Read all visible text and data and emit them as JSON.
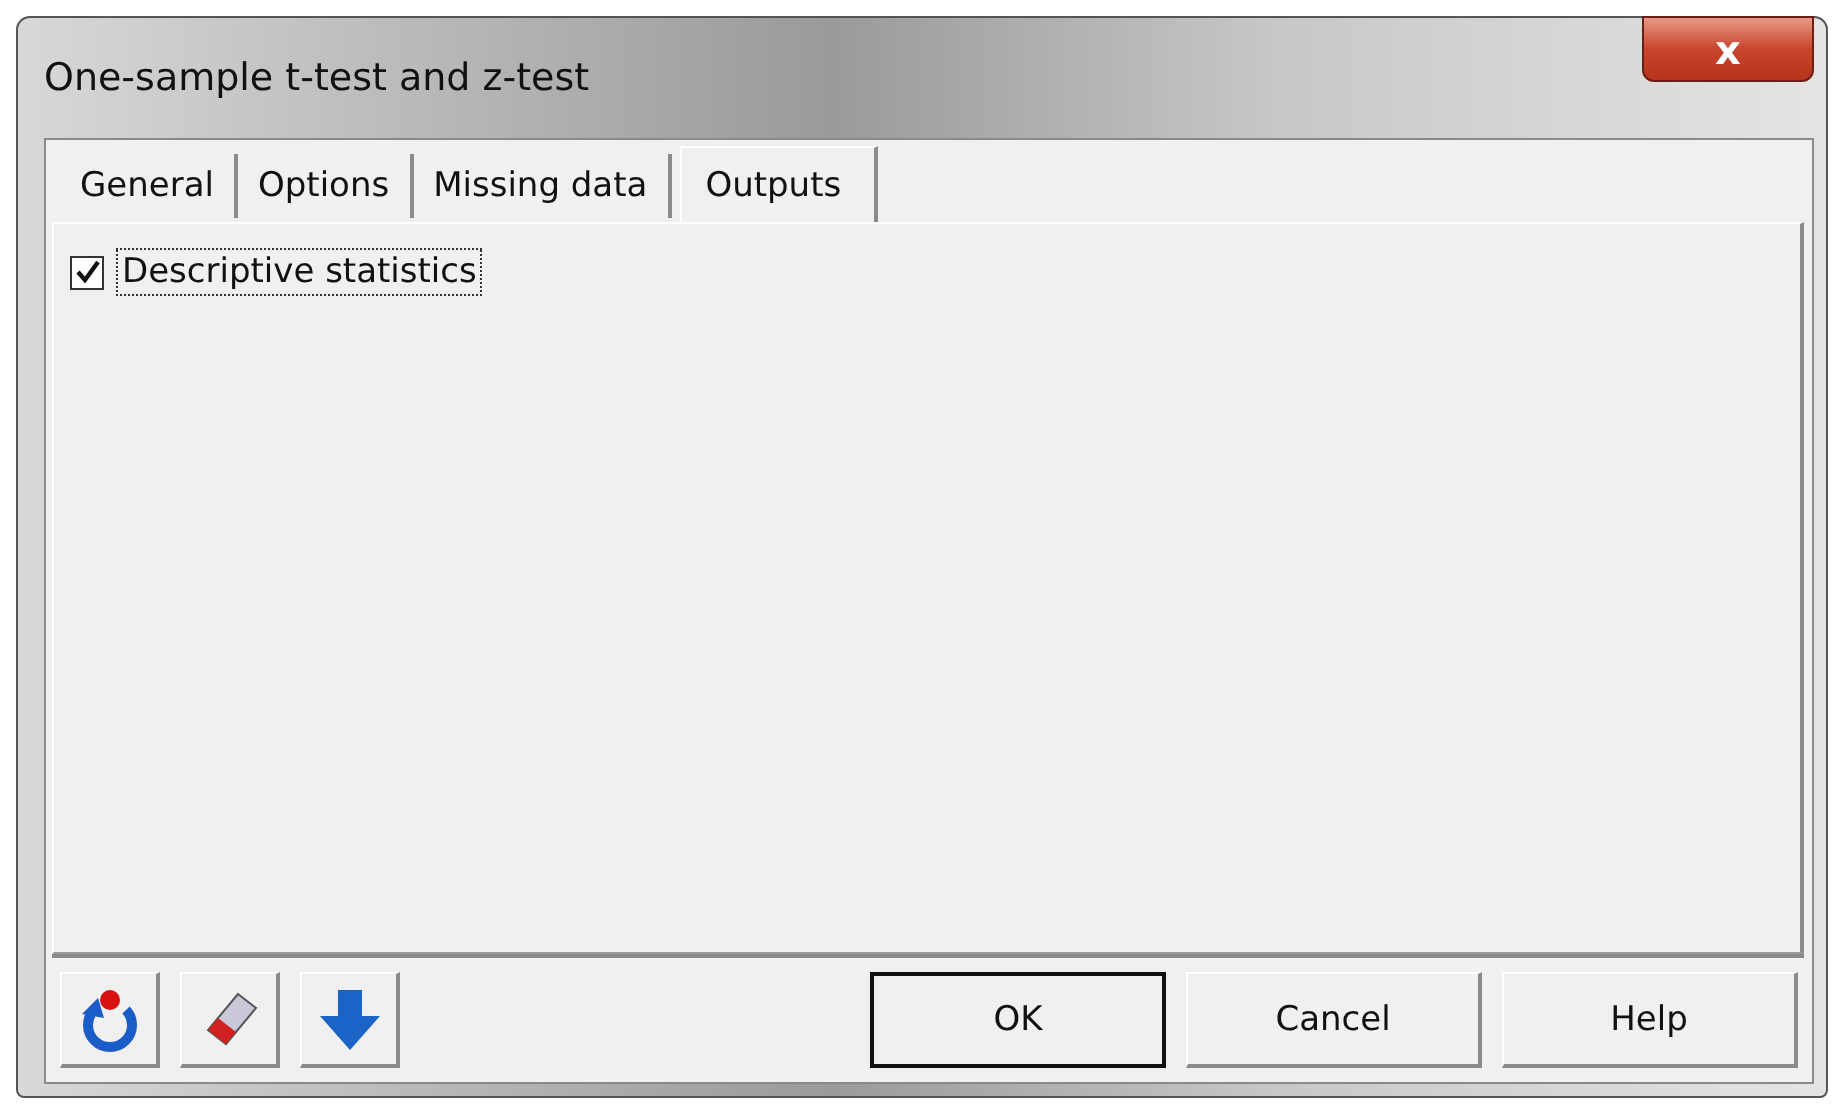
{
  "window": {
    "title": "One-sample t-test and z-test",
    "close": "x"
  },
  "tabs": [
    {
      "label": "General",
      "selected": false
    },
    {
      "label": "Options",
      "selected": false
    },
    {
      "label": "Missing data",
      "selected": false
    },
    {
      "label": "Outputs",
      "selected": true
    }
  ],
  "options": [
    {
      "label": "Descriptive statistics",
      "checked": true,
      "focused": true
    }
  ],
  "tool_buttons": [
    {
      "kind": "reset"
    },
    {
      "kind": "eraser"
    },
    {
      "kind": "down"
    }
  ],
  "buttons": [
    {
      "label": "OK",
      "default": true
    },
    {
      "label": "Cancel",
      "default": false
    },
    {
      "label": "Help",
      "default": false
    }
  ]
}
